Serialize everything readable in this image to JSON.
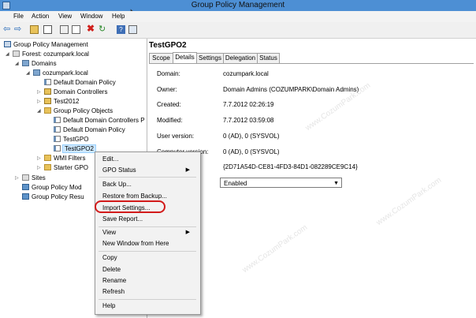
{
  "window": {
    "title": "Group Policy Management"
  },
  "menu": [
    "File",
    "Action",
    "View",
    "Window",
    "Help"
  ],
  "tree": {
    "root": "Group Policy Management",
    "forest": "Forest: cozumpark.local",
    "domains": "Domains",
    "domain": "cozumpark.local",
    "default_domain_policy": "Default Domain Policy",
    "domain_controllers": "Domain Controllers",
    "test2012": "Test2012",
    "gpo_folder": "Group Policy Objects",
    "gpo_ddcp": "Default Domain Controllers P",
    "gpo_ddp": "Default Domain Policy",
    "gpo_testgpo": "TestGPO",
    "gpo_testgpo2": "TestGPO2",
    "wmi_filters": "WMI Filters",
    "starter_gpo": "Starter GPO",
    "sites": "Sites",
    "gp_modeling": "Group Policy Mod",
    "gp_results": "Group Policy Resu"
  },
  "details": {
    "header": "TestGPO2",
    "tabs": [
      "Scope",
      "Details",
      "Settings",
      "Delegation",
      "Status"
    ],
    "active_tab": "Details",
    "rows": [
      {
        "label": "Domain:",
        "value": "cozumpark.local"
      },
      {
        "label": "Owner:",
        "value": "Domain Admins (COZUMPARK\\Domain Admins)"
      },
      {
        "label": "Created:",
        "value": "7.7.2012 02:26:19"
      },
      {
        "label": "Modified:",
        "value": "7.7.2012 03:59:08"
      },
      {
        "label": "User version:",
        "value": "0 (AD), 0 (SYSVOL)"
      },
      {
        "label": "Computer version:",
        "value": "0 (AD), 0 (SYSVOL)"
      },
      {
        "label": "",
        "value": "{2D71A54D-CE81-4FD3-84D1-082289CE9C14}"
      }
    ],
    "gpo_status": "Enabled"
  },
  "context_menu": [
    "Edit...",
    "GPO Status",
    "Back Up...",
    "Restore from Backup...",
    "Import Settings...",
    "Save Report...",
    "View",
    "New Window from Here",
    "Copy",
    "Delete",
    "Rename",
    "Refresh",
    "Help"
  ],
  "highlighted_item": "Import Settings...",
  "watermark": "www.CozumPark.com",
  "colors": {
    "titlebar": "#4d8fd4",
    "selection": "#cde8ff",
    "highlight_ring": "#d21a1a"
  }
}
